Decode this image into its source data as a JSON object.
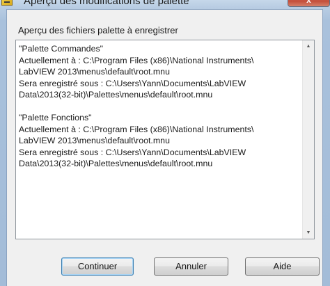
{
  "window": {
    "title": "Aperçu des modifications de palette",
    "close_symbol": "x"
  },
  "section": {
    "label": "Aperçu des fichiers palette à enregistrer"
  },
  "preview": {
    "lines": [
      "\"Palette Commandes\"",
      "Actuellement à : C:\\Program Files (x86)\\National Instruments\\",
      "LabVIEW 2013\\menus\\default\\root.mnu",
      "Sera enregistré sous : C:\\Users\\Yann\\Documents\\LabVIEW",
      "Data\\2013(32-bit)\\Palettes\\menus\\default\\root.mnu",
      "",
      "\"Palette Fonctions\"",
      "Actuellement à : C:\\Program Files (x86)\\National Instruments\\",
      "LabVIEW 2013\\menus\\default\\root.mnu",
      "Sera enregistré sous : C:\\Users\\Yann\\Documents\\LabVIEW",
      "Data\\2013(32-bit)\\Palettes\\menus\\default\\root.mnu"
    ]
  },
  "scrollbar": {
    "up_icon": "scroll-up-arrow",
    "down_icon": "scroll-down-arrow"
  },
  "buttons": {
    "continuer": "Continuer",
    "annuler": "Annuler",
    "aide": "Aide"
  },
  "colors": {
    "frame": "#a9c1dc",
    "client": "#f0f0f0",
    "default_button_border": "#3c7fb1"
  }
}
